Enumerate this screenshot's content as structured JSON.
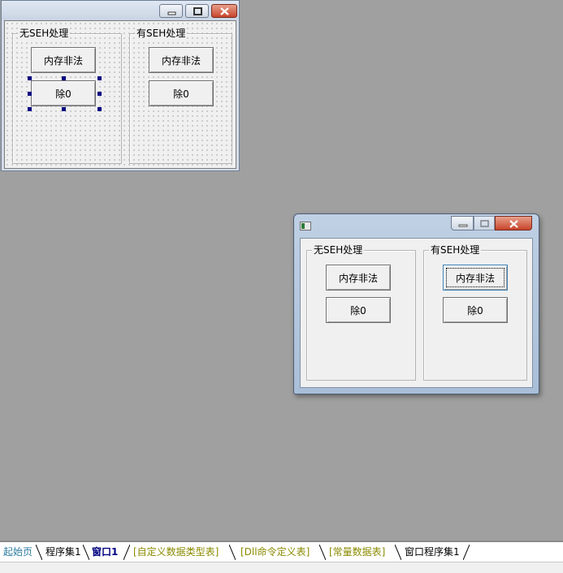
{
  "design_window": {
    "group_left_title": "无SEH处理",
    "group_right_title": "有SEH处理",
    "left_buttons": [
      "内存非法",
      "除0"
    ],
    "right_buttons": [
      "内存非法",
      "除0"
    ]
  },
  "run_window": {
    "group_left_title": "无SEH处理",
    "group_right_title": "有SEH处理",
    "left_buttons": [
      "内存非法",
      "除0"
    ],
    "right_buttons": [
      "内存非法",
      "除0"
    ]
  },
  "tabs": [
    {
      "label": "起始页",
      "color": "#2a7aa0"
    },
    {
      "label": "程序集1",
      "color": "#000000"
    },
    {
      "label": "窗口1",
      "color": "#000080",
      "active": true
    },
    {
      "label": "[自定义数据类型表]",
      "color": "#8a8a00"
    },
    {
      "label": "[Dll命令定义表]",
      "color": "#8a8a00"
    },
    {
      "label": "[常量数据表]",
      "color": "#8a8a00"
    },
    {
      "label": "窗口程序集1",
      "color": "#000000"
    }
  ],
  "colors": {
    "workspace": "#a0a0a0",
    "selection_handle": "#000080",
    "close_button": "#c8442a"
  }
}
